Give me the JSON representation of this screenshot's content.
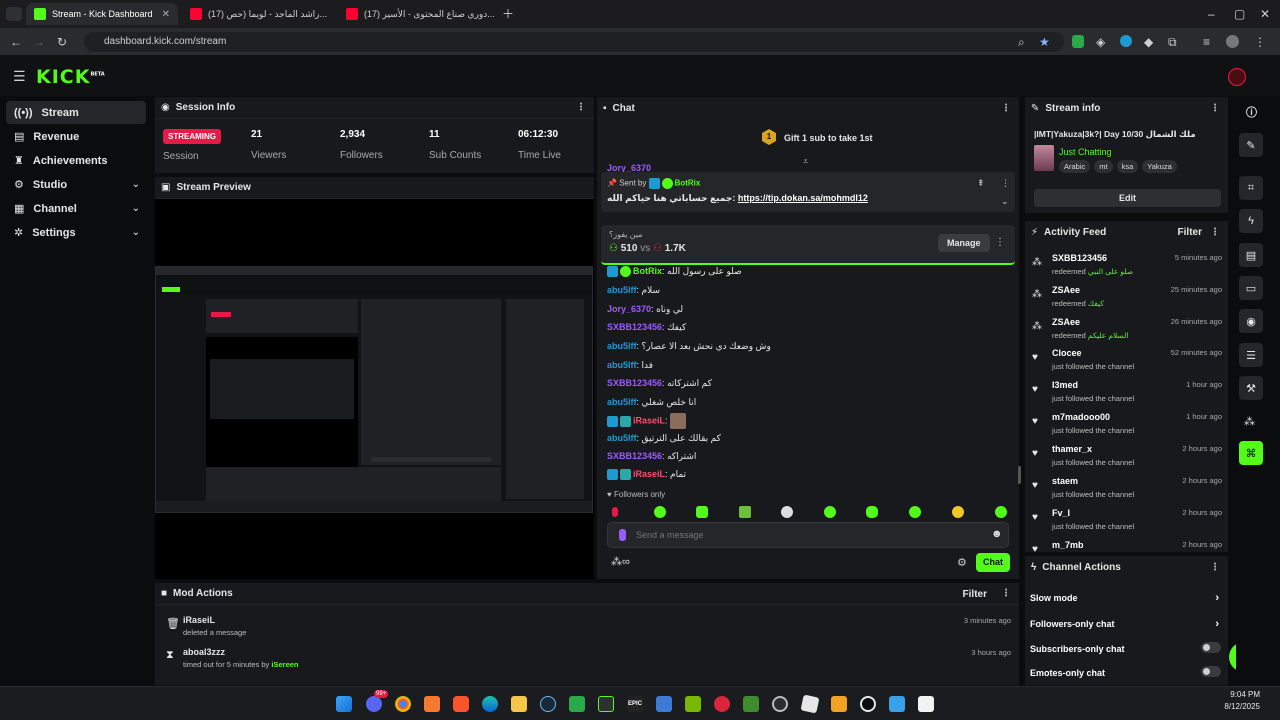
{
  "browser": {
    "tabs": [
      {
        "title": "Stream - Kick Dashboard",
        "active": true
      },
      {
        "title": "(17) راشد الماجد - لويما (حص...",
        "active": false
      },
      {
        "title": "(17) دوري صناع المحتوى - الأسير...",
        "active": false
      }
    ],
    "url": "dashboard.kick.com/stream"
  },
  "brand": {
    "logo": "KICK",
    "beta": "BETA",
    "accent": "#53fc18",
    "live_color": "#e91947"
  },
  "sidebar": {
    "items": [
      {
        "label": "Stream",
        "icon": "broadcast-icon"
      },
      {
        "label": "Revenue",
        "icon": "dollar-icon"
      },
      {
        "label": "Achievements",
        "icon": "trophy-icon"
      },
      {
        "label": "Studio",
        "icon": "studio-icon"
      },
      {
        "label": "Channel",
        "icon": "channel-icon"
      },
      {
        "label": "Settings",
        "icon": "gear-icon"
      }
    ]
  },
  "session": {
    "title": "Session Info",
    "status": "STREAMING",
    "status_label": "Session",
    "viewers": "21",
    "viewers_label": "Viewers",
    "followers": "2,934",
    "followers_label": "Followers",
    "subs": "11",
    "subs_label": "Sub Counts",
    "time": "06:12:30",
    "time_label": "Time Live"
  },
  "preview": {
    "title": "Stream Preview"
  },
  "chat": {
    "title": "Chat",
    "gift": "Gift 1 sub to take 1st",
    "gift_rank": "1",
    "pinned": {
      "sent_by": "Sent by",
      "user": "BotRix",
      "text": "جميع حساباتي هنا حياكم الله:",
      "link": "https://tip.dokan.sa/mohmdl12"
    },
    "poll": {
      "question": "مين يفوز؟",
      "left": "510",
      "vs": "vs",
      "right": "1.7K",
      "manage": "Manage"
    },
    "messages": [
      {
        "user": "BotRix",
        "text": "صلو على رسول الله",
        "color": "#53fc18"
      },
      {
        "user": "abu5lff",
        "text": "سلام",
        "color": "#1d9bd1"
      },
      {
        "user": "Jory_6370",
        "text": "لي وناه",
        "color": "#9b5cff"
      },
      {
        "user": "SXBB123456",
        "text": "كيفك",
        "color": "#9b5cff"
      },
      {
        "user": "abu5lff",
        "text": "وش وضعك دي نحش بعد الا عصار؟",
        "color": "#1d9bd1"
      },
      {
        "user": "abu5lff",
        "text": "فدا",
        "color": "#1d9bd1"
      },
      {
        "user": "SXBB123456",
        "text": "كم اشتركاته",
        "color": "#9b5cff"
      },
      {
        "user": "abu5lff",
        "text": "انا خلص شغلي",
        "color": "#1d9bd1"
      },
      {
        "user": "iRaseiL",
        "text": "",
        "color": "#ff4d6d"
      },
      {
        "user": "abu5lff",
        "text": "كم بقالك على الترتيق",
        "color": "#1d9bd1"
      },
      {
        "user": "SXBB123456",
        "text": "اشتراكه",
        "color": "#9b5cff"
      },
      {
        "user": "iRaseiL",
        "text": "تمام",
        "color": "#ff4d6d"
      }
    ],
    "scrolled_user": "Jory_6370",
    "followers_only": "Followers only",
    "placeholder": "Send a message",
    "send": "Chat",
    "infinity": "∞"
  },
  "mod": {
    "title": "Mod Actions",
    "filter": "Filter",
    "items": [
      {
        "user": "iRaseiL",
        "action": "deleted a message",
        "time": "3 minutes ago"
      },
      {
        "user": "aboal3zzz",
        "action": "timed out for 5 minutes by",
        "by": "iSereen",
        "time": "3 hours ago"
      }
    ]
  },
  "streaminfo": {
    "title": "Stream info",
    "stream_title": "|IMT|Yakuza|3k?| Day 10/30 ملك الشمال",
    "category": "Just Chatting",
    "tags": [
      "Arabic",
      "mt",
      "ksa",
      "Yakuza"
    ],
    "edit": "Edit"
  },
  "activity": {
    "title": "Activity Feed",
    "filter": "Filter",
    "items": [
      {
        "user": "SXBB123456",
        "action": "redeemed",
        "reward": "صلو على النبي",
        "time": "5 minutes ago",
        "icon": "redeem-icon"
      },
      {
        "user": "ZSAee",
        "action": "redeemed",
        "reward": "كيفك",
        "time": "25 minutes ago",
        "icon": "redeem-icon"
      },
      {
        "user": "ZSAee",
        "action": "redeemed",
        "reward": "السلام عليكم",
        "time": "26 minutes ago",
        "icon": "redeem-icon"
      },
      {
        "user": "Clocee",
        "action": "just followed the channel",
        "reward": "",
        "time": "52 minutes ago",
        "icon": "heart-icon"
      },
      {
        "user": "I3med",
        "action": "just followed the channel",
        "reward": "",
        "time": "1 hour ago",
        "icon": "heart-icon"
      },
      {
        "user": "m7madooo00",
        "action": "just followed the channel",
        "reward": "",
        "time": "1 hour ago",
        "icon": "heart-icon"
      },
      {
        "user": "thamer_x",
        "action": "just followed the channel",
        "reward": "",
        "time": "2 hours ago",
        "icon": "heart-icon"
      },
      {
        "user": "staem",
        "action": "just followed the channel",
        "reward": "",
        "time": "2 hours ago",
        "icon": "heart-icon"
      },
      {
        "user": "Fv_I",
        "action": "just followed the channel",
        "reward": "",
        "time": "2 hours ago",
        "icon": "heart-icon"
      },
      {
        "user": "m_7mb",
        "action": "",
        "reward": "",
        "time": "2 hours ago",
        "icon": "heart-icon"
      }
    ]
  },
  "channel_actions": {
    "title": "Channel Actions",
    "items": [
      {
        "label": "Slow mode",
        "kind": "chevron"
      },
      {
        "label": "Followers-only chat",
        "kind": "chevron"
      },
      {
        "label": "Subscribers-only chat",
        "kind": "toggle"
      },
      {
        "label": "Emotes-only chat",
        "kind": "toggle"
      }
    ]
  },
  "taskbar": {
    "time": "9:04 PM",
    "date": "8/12/2025",
    "notif": "99+"
  }
}
